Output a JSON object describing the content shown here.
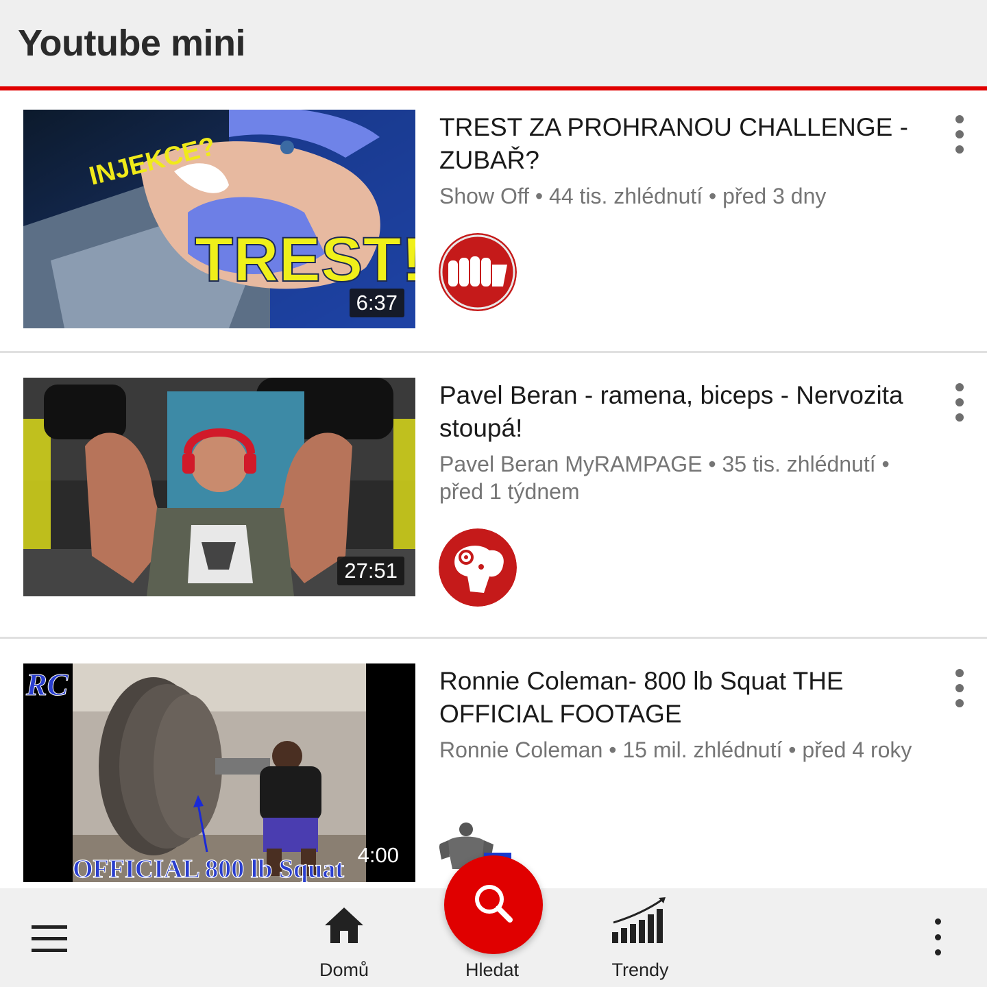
{
  "app": {
    "title": "Youtube mini"
  },
  "colors": {
    "accent": "#e00000",
    "header_bg": "#efefef",
    "bottom_bg": "#f0f0f0"
  },
  "videos": [
    {
      "title": "TREST ZA PROHRANOU CHALLENGE - ZUBAŘ?",
      "meta": "Show Off • 44 tis. zhlédnutí • před 3 dny",
      "duration": "6:37",
      "thumb_text_1": "INJEKCE?",
      "thumb_text_2": "TREST!"
    },
    {
      "title": "Pavel Beran - ramena, biceps - Nervozita stoupá!",
      "meta": "Pavel Beran MyRAMPAGE • 35 tis. zhlédnutí • před 1 týdnem",
      "duration": "27:51"
    },
    {
      "title": "Ronnie Coleman- 800 lb Squat THE OFFICIAL FOOTAGE",
      "meta": "Ronnie Coleman • 15 mil. zhlédnutí • před 4 roky",
      "duration": "4:00",
      "thumb_text_1": "OFFICIAL 800 lb Squat",
      "thumb_logo": "RC"
    }
  ],
  "bottom_nav": {
    "home_label": "Domů",
    "search_label": "Hledat",
    "trending_label": "Trendy",
    "menu_icon": "hamburger-menu-icon",
    "more_icon": "vertical-dots-icon"
  }
}
